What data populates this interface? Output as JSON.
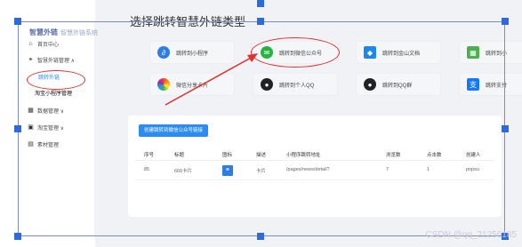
{
  "sidebar": {
    "logo_main": "智慧外链",
    "logo_sub": "智慧外链系统",
    "items": [
      {
        "label": "首页中心",
        "icon": "home-icon",
        "glyph": "⌂"
      },
      {
        "label": "智慧外链管理 ∧",
        "icon": "link-icon",
        "glyph": "⚭"
      },
      {
        "label": "跳转外链",
        "active": true
      },
      {
        "label": "淘宝小程序管理",
        "active": false
      },
      {
        "label": "数据管理 ∨",
        "icon": "grid-icon",
        "glyph": "▦"
      },
      {
        "label": "淘宝管理 ∨",
        "icon": "bag-icon",
        "glyph": "▣"
      },
      {
        "label": "素材管理",
        "icon": "file-icon",
        "glyph": "▤"
      }
    ]
  },
  "main": {
    "heading": "选择跳转智慧外链类型",
    "cards_row1": [
      {
        "label": "跳转到小程序",
        "icon": "miniprogram-icon",
        "glyph": "∂",
        "color": "#2f7de1"
      },
      {
        "label": "跳转到微信公众号",
        "icon": "wechat-icon",
        "glyph": "✉",
        "color": "#27b33f"
      },
      {
        "label": "跳转到金山文档",
        "icon": "kdocs-icon",
        "glyph": "◆",
        "color": "#1e88e5"
      },
      {
        "label": "跳转到小",
        "icon": "qrcode-icon",
        "glyph": "▦",
        "color": "#4caf50"
      }
    ],
    "cards_row2": [
      {
        "label": "微信分享卡片",
        "icon": "palette-icon",
        "glyph": "✺",
        "color": "#ff9800"
      },
      {
        "label": "跳转到个人QQ",
        "icon": "qq-icon",
        "glyph": "●",
        "color": "#222222"
      },
      {
        "label": "跳转到QQ群",
        "icon": "qq-group-icon",
        "glyph": "●",
        "color": "#222222"
      },
      {
        "label": "跳转支付",
        "icon": "alipay-icon",
        "glyph": "支",
        "color": "#1677ff"
      }
    ]
  },
  "panel": {
    "button": "创建跳转到微信公众号链接",
    "headers": [
      "序号",
      "标题",
      "图标",
      "描述",
      "小程序跳转地址",
      "浏览数",
      "点击数",
      "创建人"
    ],
    "row": [
      "85",
      "666卡片",
      "",
      "卡片",
      "/pages/news/detail?",
      "7",
      "1",
      "popsu"
    ]
  },
  "watermark": "CSDN @qq_21256185",
  "colors": {
    "accent": "#2d8cf0",
    "annotation_red": "#e03030",
    "frame_blue": "#2f6bd8"
  }
}
